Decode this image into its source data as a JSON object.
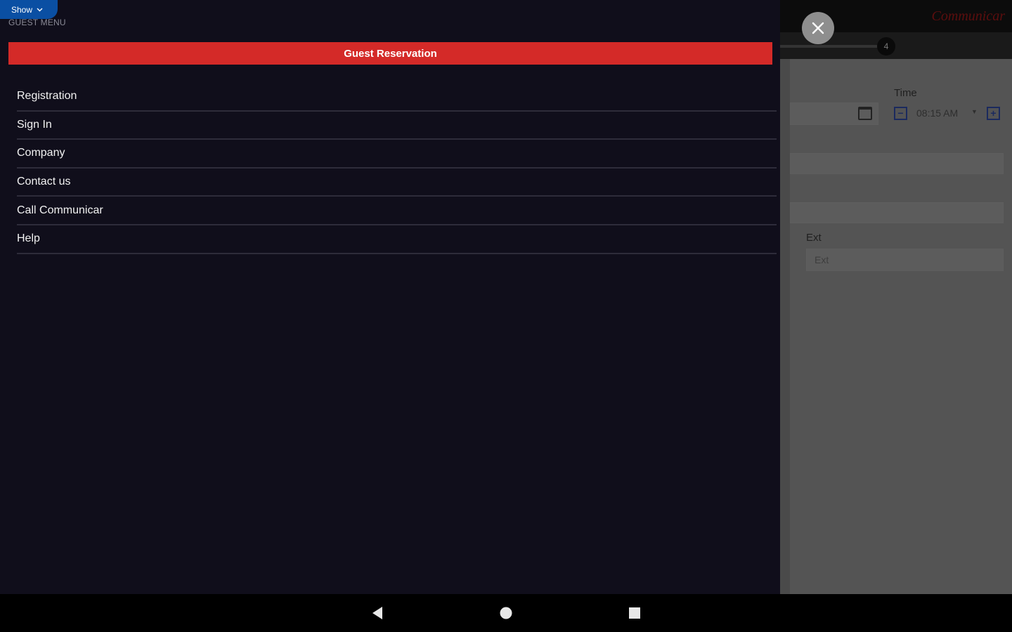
{
  "background": {
    "step_number": "4",
    "time_label": "Time",
    "time_value": "08:15 AM",
    "ext_label": "Ext",
    "ext_placeholder": "Ext",
    "logo_text": "Communicar"
  },
  "drawer": {
    "show_toggle_label": "Show",
    "menu_heading": "GUEST MENU",
    "primary_button_label": "Guest Reservation",
    "menu_items": [
      {
        "label": "Registration"
      },
      {
        "label": "Sign In"
      },
      {
        "label": "Company"
      },
      {
        "label": "Contact us"
      },
      {
        "label": "Call Communicar"
      },
      {
        "label": "Help"
      }
    ]
  },
  "colors": {
    "drawer_bg": "#100e1b",
    "accent_red": "#d42a28",
    "toggle_blue": "#0a4fa3",
    "overlay_gray": "#4a4a4a"
  },
  "icons": {
    "close": "close-icon",
    "toggle": "chevron-down-icon",
    "calendar": "calendar-icon",
    "nav_back": "back-triangle-icon",
    "nav_home": "home-circle-icon",
    "nav_recents": "recents-square-icon"
  }
}
